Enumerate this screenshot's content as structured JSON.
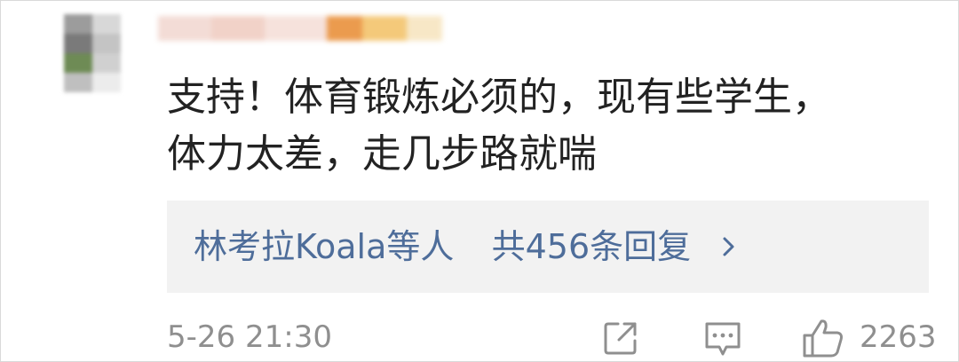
{
  "comment": {
    "text": "支持！体育锻炼必须的，现有些学生，\n体力太差，走几步路就喘",
    "timestamp": "5-26 21:30"
  },
  "replies": {
    "summary_users": "林考拉Koala等人",
    "summary_count": "共456条回复",
    "icon": "chevron-right-icon"
  },
  "actions": {
    "share_icon": "share-icon",
    "comment_icon": "comment-icon",
    "like_icon": "like-icon",
    "like_count": "2263"
  },
  "colors": {
    "text": "#222222",
    "link": "#4e6d9a",
    "muted": "#8f8f8f",
    "reply_bg": "#f2f2f2"
  }
}
